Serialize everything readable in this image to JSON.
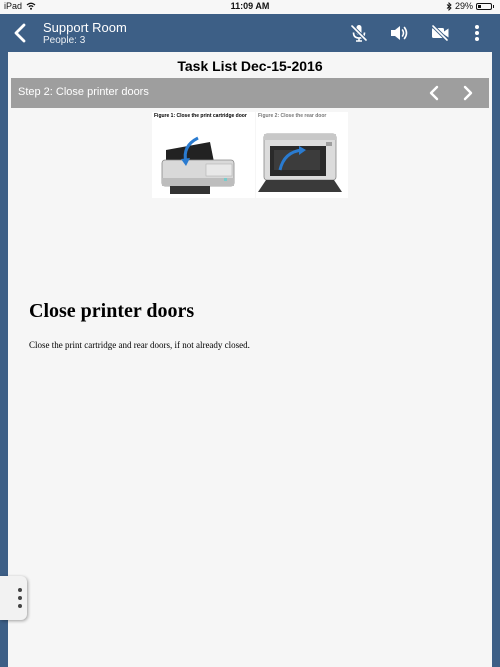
{
  "status_bar": {
    "device": "iPad",
    "time": "11:09 AM",
    "battery": "29%",
    "battery_level": 0.29
  },
  "header": {
    "title": "Support Room",
    "subtitle": "People: 3"
  },
  "task": {
    "title": "Task List Dec-15-2016",
    "step_label": "Step 2: Close printer doors"
  },
  "figures": [
    {
      "caption": "Figure 1: Close the print cartridge door"
    },
    {
      "caption": "Figure 2: Close the rear door"
    }
  ],
  "content": {
    "heading": "Close printer doors",
    "description": "Close the print cartridge and rear doors, if not already closed."
  },
  "colors": {
    "header_bg": "#3d5f86",
    "step_bar": "#9e9e9e",
    "content_bg": "#f6f6f6"
  },
  "icons": {
    "back": "chevron-left-icon",
    "mute": "microphone-off-icon",
    "speaker": "speaker-icon",
    "video": "video-off-icon",
    "more": "more-vertical-icon",
    "prev": "chevron-left-icon",
    "next": "chevron-right-icon",
    "handle": "more-vertical-icon"
  }
}
